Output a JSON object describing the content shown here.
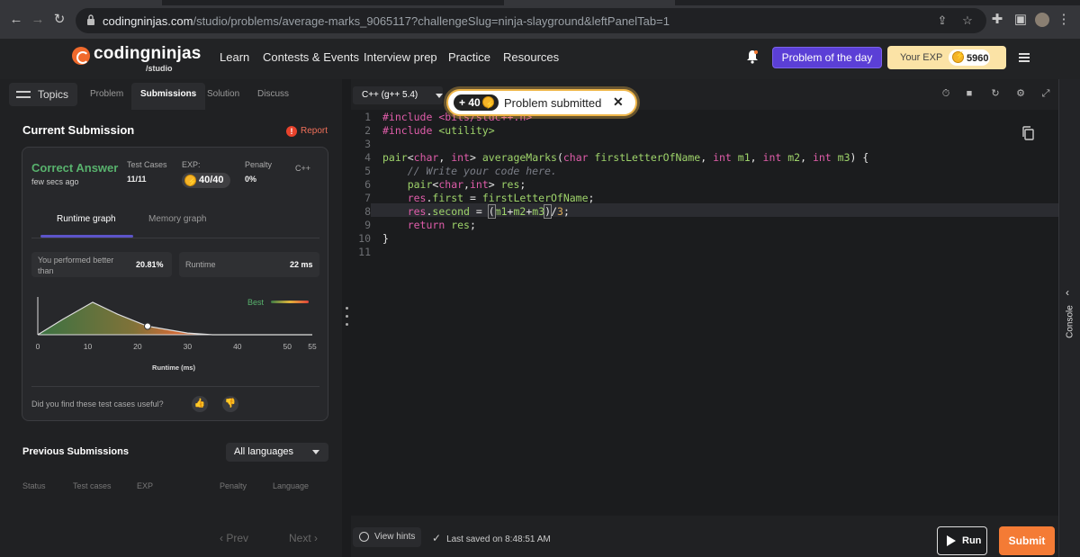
{
  "browser": {
    "url_host": "codingninjas.com",
    "url_path": "/studio/problems/average-marks_9065117?challengeSlug=ninja-slayground&leftPanelTab=1"
  },
  "topnav": {
    "logo_name": "codingninjas",
    "logo_sub": "/studio",
    "links": [
      "Learn",
      "Contests & Events",
      "Interview prep",
      "Practice",
      "Resources"
    ],
    "potd_label": "Problem of the day",
    "exp_label": "Your EXP",
    "exp_value": "5960"
  },
  "left": {
    "topics_label": "Topics",
    "tabs": [
      "Problem",
      "Submissions",
      "Solution",
      "Discuss"
    ],
    "active_tab": "Submissions",
    "current_title": "Current Submission",
    "report_label": "Report",
    "status": "Correct Answer",
    "time_ago": "few secs ago",
    "test_cases_label": "Test Cases",
    "test_cases_value": "11/11",
    "exp_label": "EXP:",
    "exp_value": "40/40",
    "penalty_label": "Penalty",
    "penalty_value": "0%",
    "language": "C++",
    "graph_tabs": [
      "Runtime graph",
      "Memory graph"
    ],
    "performed_label": "You performed better than",
    "performed_value": "20.81%",
    "runtime_label": "Runtime",
    "runtime_value": "22 ms",
    "best_label": "Best",
    "question": "Did you find these test cases useful?",
    "prev_title": "Previous Submissions",
    "lang_filter": "All languages",
    "prev_headers": [
      "Status",
      "Test cases",
      "EXP",
      "Penalty",
      "Language"
    ],
    "prev_btn": "Prev",
    "next_btn": "Next"
  },
  "chart_data": {
    "type": "area",
    "xlabel": "Runtime (ms)",
    "ylabel": "",
    "xlim": [
      0,
      55
    ],
    "xticks": [
      0,
      10,
      20,
      30,
      40,
      50,
      55
    ],
    "x": [
      0,
      5,
      11,
      16,
      22,
      30,
      35,
      40,
      45,
      50,
      55
    ],
    "y": [
      0,
      0.45,
      0.95,
      0.6,
      0.25,
      0.05,
      0,
      0,
      0,
      0,
      0
    ],
    "marker": {
      "x": 22,
      "y": 0.25
    },
    "legend": "Best"
  },
  "editor": {
    "language": "C++ (g++ 5.4)",
    "toast_plus": "+ 40",
    "toast_msg": "Problem submitted",
    "line_numbers": [
      "1",
      "2",
      "3",
      "4",
      "5",
      "6",
      "7",
      "8",
      "9",
      "10",
      "11"
    ],
    "hints_label": "View hints",
    "saved_label": "Last saved on 8:48:51 AM",
    "run_label": "Run",
    "submit_label": "Submit"
  },
  "console_label": "Console"
}
